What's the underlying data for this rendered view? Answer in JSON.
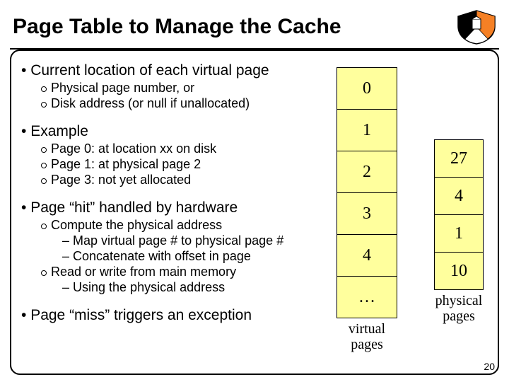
{
  "title": "Page Table to Manage the Cache",
  "bullets": {
    "b1_0": "Current location of each virtual page",
    "b2_0": "Physical page number, or",
    "b2_1": "Disk address (or null if unallocated)",
    "b1_1": "Example",
    "b2_2": "Page 0: at location xx on disk",
    "b2_3": "Page 1: at physical page 2",
    "b2_4": "Page 3: not yet allocated",
    "b1_2": "Page “hit” handled by hardware",
    "b2_5": "Compute the physical address",
    "b3_0": "Map virtual page # to physical page #",
    "b3_1": "Concatenate with offset in page",
    "b2_6": "Read or write from main memory",
    "b3_2": "Using the physical address",
    "b1_3": "Page “miss” triggers an exception"
  },
  "virtual": {
    "cells": [
      "0",
      "1",
      "2",
      "3",
      "4",
      "…"
    ],
    "label_line1": "virtual",
    "label_line2": "pages"
  },
  "physical": {
    "cells": [
      "27",
      "4",
      "1",
      "10"
    ],
    "label_line1": "physical",
    "label_line2": "pages"
  },
  "page_number": "20"
}
